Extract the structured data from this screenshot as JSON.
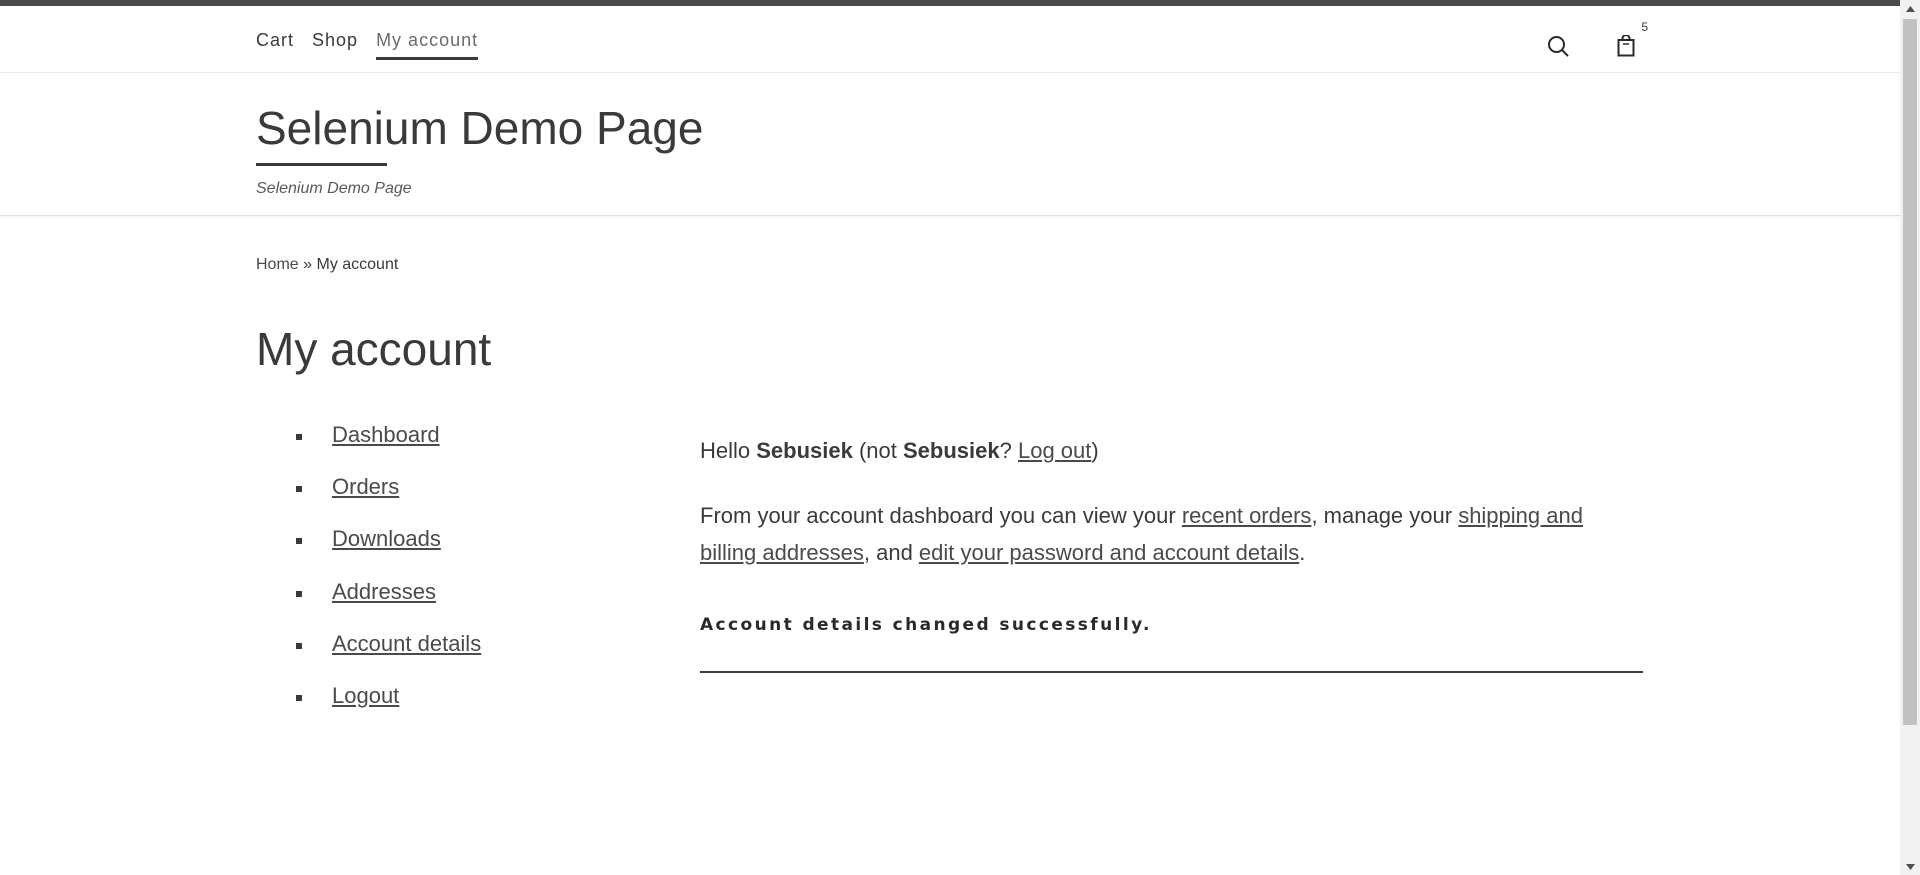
{
  "nav": {
    "items": [
      {
        "label": "Cart"
      },
      {
        "label": "Shop"
      },
      {
        "label": "My account"
      }
    ],
    "cart_count": "5"
  },
  "branding": {
    "title": "Selenium Demo Page",
    "description": "Selenium Demo Page"
  },
  "breadcrumb": {
    "home": "Home",
    "separator": " » ",
    "current": "My account"
  },
  "page": {
    "title": "My account"
  },
  "account_nav": {
    "items": [
      {
        "label": "Dashboard"
      },
      {
        "label": "Orders"
      },
      {
        "label": "Downloads"
      },
      {
        "label": "Addresses"
      },
      {
        "label": "Account details"
      },
      {
        "label": "Logout"
      }
    ]
  },
  "greeting": {
    "hello": "Hello ",
    "username": "Sebusiek",
    "not_prefix": " (not ",
    "username2": "Sebusiek",
    "question": "? ",
    "logout": "Log out",
    "close": ")"
  },
  "dashboard": {
    "text1": "From your account dashboard you can view your ",
    "link_orders": "recent orders",
    "text2": ", manage your ",
    "link_addresses": "shipping and billing addresses",
    "text3": ", and ",
    "link_details": "edit your password and account details",
    "text4": "."
  },
  "notice": {
    "message": "Account details changed successfully."
  },
  "icons": {
    "search": "search-icon",
    "cart": "shopping-bag-icon"
  }
}
